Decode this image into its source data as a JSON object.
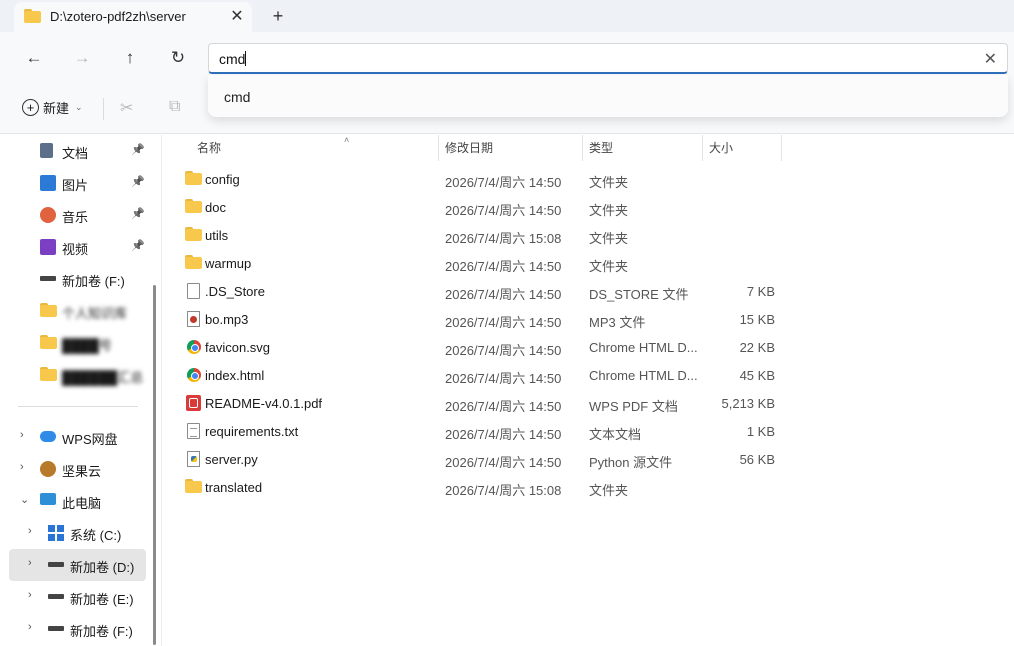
{
  "tab": {
    "title": "D:\\zotero-pdf2zh\\server",
    "close": "✕",
    "new_tab": "+"
  },
  "nav": {
    "back": "←",
    "forward": "→",
    "up": "↑",
    "refresh": "↻"
  },
  "address": {
    "value": "cmd",
    "clear": "✕"
  },
  "suggestions": [
    "cmd"
  ],
  "toolbar": {
    "new_label": "新建",
    "new_chevron": "⌄",
    "cut_icon": "✂",
    "copy_icon": "⧉"
  },
  "sidebar": {
    "quick": [
      {
        "label": "文档",
        "icon": "documents-icon",
        "pin": "📌"
      },
      {
        "label": "图片",
        "icon": "pictures-icon",
        "pin": "📌"
      },
      {
        "label": "音乐",
        "icon": "music-icon",
        "pin": "📌"
      },
      {
        "label": "视频",
        "icon": "videos-icon",
        "pin": "📌"
      },
      {
        "label": "新加卷 (F:)",
        "icon": "drive-icon"
      },
      {
        "label": "个人知识库",
        "icon": "folder-icon",
        "blurred": true
      },
      {
        "label": "████号",
        "icon": "folder-icon",
        "blurred": true
      },
      {
        "label": "██████汇总",
        "icon": "folder-icon",
        "blurred": true
      }
    ],
    "tree": [
      {
        "label": "WPS网盘",
        "icon": "wps-cloud-icon",
        "expander": "›"
      },
      {
        "label": "坚果云",
        "icon": "nutstore-icon",
        "expander": "›"
      },
      {
        "label": "此电脑",
        "icon": "this-pc-icon",
        "expander": "⌄"
      },
      {
        "label": "系统 (C:)",
        "icon": "windows-drive-icon",
        "expander": "›"
      },
      {
        "label": "新加卷 (D:)",
        "icon": "drive-icon",
        "expander": "›",
        "selected": true
      },
      {
        "label": "新加卷 (E:)",
        "icon": "drive-icon",
        "expander": "›"
      },
      {
        "label": "新加卷 (F:)",
        "icon": "drive-icon",
        "expander": "›"
      }
    ]
  },
  "columns": {
    "name": "名称",
    "date": "修改日期",
    "type": "类型",
    "size": "大小",
    "sort_arrow": "˄"
  },
  "files": [
    {
      "name": "config",
      "date": "2026/7/4/周六 14:50",
      "type": "文件夹",
      "size": "",
      "icon": "folder"
    },
    {
      "name": "doc",
      "date": "2026/7/4/周六 14:50",
      "type": "文件夹",
      "size": "",
      "icon": "folder"
    },
    {
      "name": "utils",
      "date": "2026/7/4/周六 15:08",
      "type": "文件夹",
      "size": "",
      "icon": "folder"
    },
    {
      "name": "warmup",
      "date": "2026/7/4/周六 14:50",
      "type": "文件夹",
      "size": "",
      "icon": "folder"
    },
    {
      "name": ".DS_Store",
      "date": "2026/7/4/周六 14:50",
      "type": "DS_STORE 文件",
      "size": "7 KB",
      "icon": "doc"
    },
    {
      "name": "bo.mp3",
      "date": "2026/7/4/周六 14:50",
      "type": "MP3 文件",
      "size": "15 KB",
      "icon": "mp3"
    },
    {
      "name": "favicon.svg",
      "date": "2026/7/4/周六 14:50",
      "type": "Chrome HTML D...",
      "size": "22 KB",
      "icon": "chrome"
    },
    {
      "name": "index.html",
      "date": "2026/7/4/周六 14:50",
      "type": "Chrome HTML D...",
      "size": "45 KB",
      "icon": "chrome"
    },
    {
      "name": "README-v4.0.1.pdf",
      "date": "2026/7/4/周六 14:50",
      "type": "WPS PDF 文档",
      "size": "5,213 KB",
      "icon": "pdf"
    },
    {
      "name": "requirements.txt",
      "date": "2026/7/4/周六 14:50",
      "type": "文本文档",
      "size": "1 KB",
      "icon": "doc lines"
    },
    {
      "name": "server.py",
      "date": "2026/7/4/周六 14:50",
      "type": "Python 源文件",
      "size": "56 KB",
      "icon": "py"
    },
    {
      "name": "translated",
      "date": "2026/7/4/周六 15:08",
      "type": "文件夹",
      "size": "",
      "icon": "folder"
    }
  ]
}
